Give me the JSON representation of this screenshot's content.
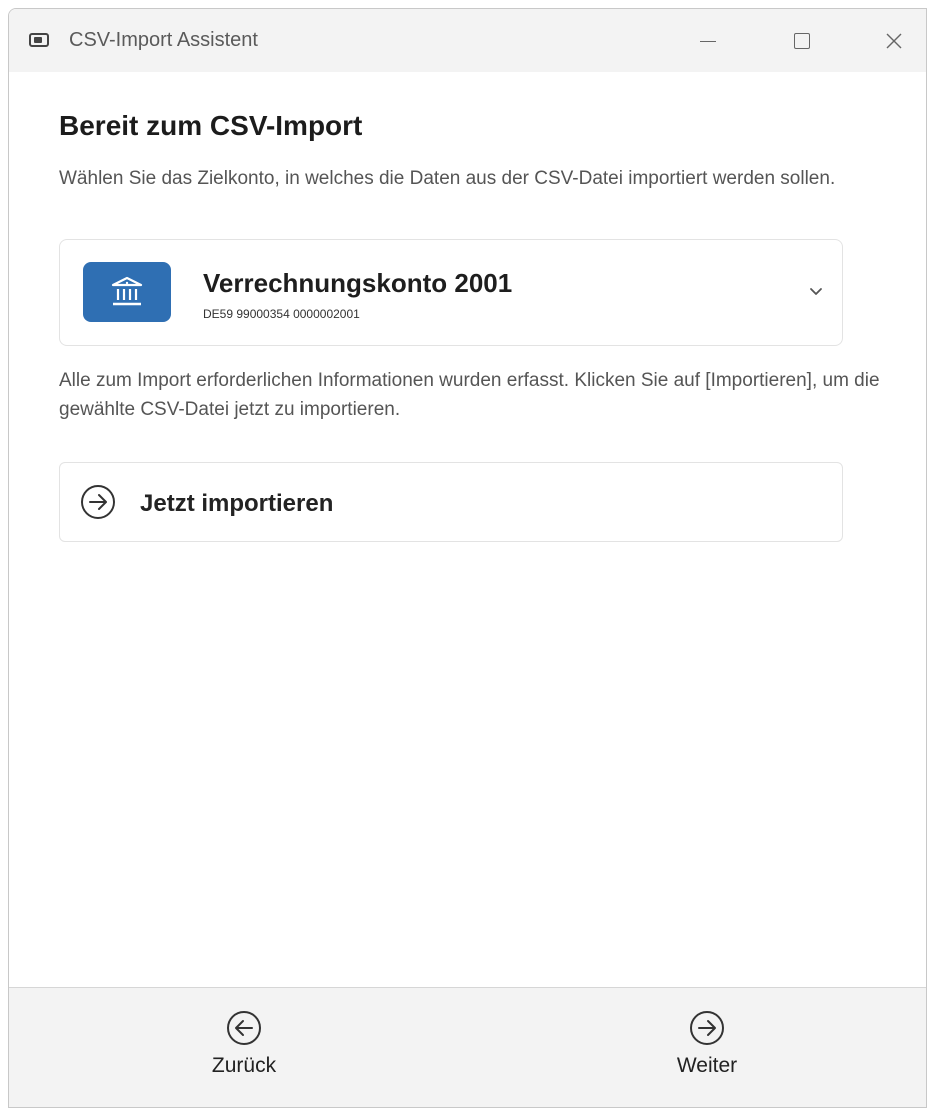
{
  "window": {
    "title": "CSV-Import Assistent"
  },
  "main": {
    "heading": "Bereit zum CSV-Import",
    "description": "Wählen Sie das Zielkonto, in welches die Daten aus der CSV-Datei importiert werden sollen.",
    "account": {
      "name": "Verrechnungskonto 2001",
      "iban": "DE59 99000354 0000002001",
      "icon": "bank-icon",
      "dropdown_icon": "chevron-down-icon"
    },
    "info": "Alle zum Import erforderlichen Informationen wurden erfasst. Klicken Sie auf [Importieren], um die gewählte CSV-Datei jetzt zu importieren.",
    "import_button": {
      "label": "Jetzt importieren",
      "icon": "arrow-right-circle-icon"
    }
  },
  "footer": {
    "back_label": "Zurück",
    "next_label": "Weiter"
  },
  "colors": {
    "accent": "#2f6fb3",
    "titlebar": "#f3f3f3",
    "footer": "#f3f3f3"
  }
}
